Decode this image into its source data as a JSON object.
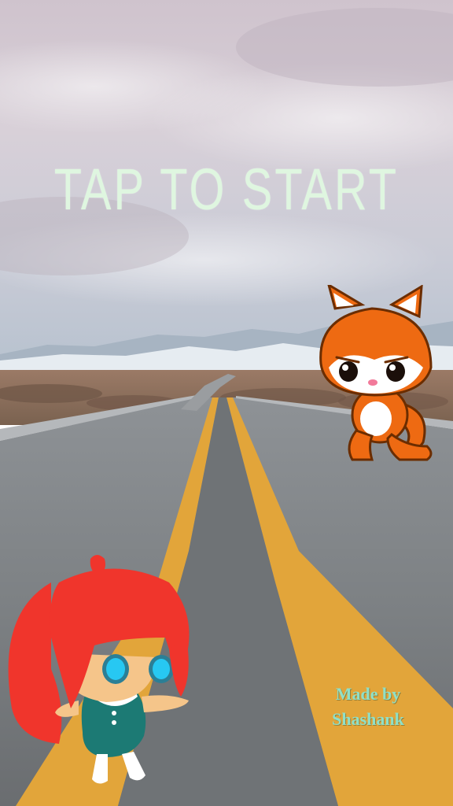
{
  "start_screen": {
    "title": "TAP TO START",
    "credit_line1": "Made by",
    "credit_line2": "Shashank"
  },
  "characters": [
    {
      "name": "fox-character",
      "color": "#ee6a12"
    },
    {
      "name": "red-haired-girl-character",
      "color": "#f0352c"
    }
  ],
  "colors": {
    "title_text": "#dff6e0",
    "credit_text": "#8fe0c8",
    "road_line": "#e2a53a"
  }
}
